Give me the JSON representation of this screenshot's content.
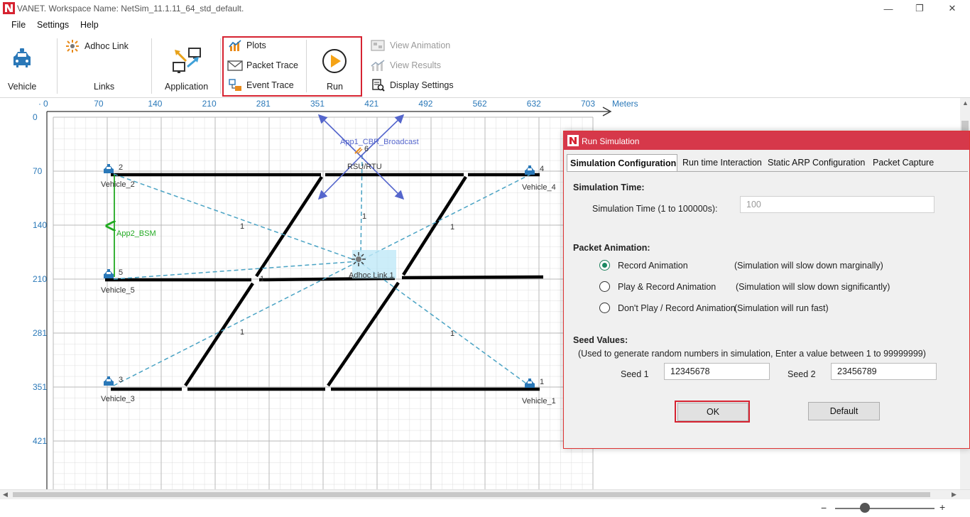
{
  "window": {
    "title": "VANET. Workspace Name: NetSim_11.1.11_64_std_default.",
    "minimize": "—",
    "restore": "❐",
    "close": "✕"
  },
  "menu": [
    "File",
    "Settings",
    "Help"
  ],
  "ribbon": {
    "vehicle": "Vehicle",
    "adhoc_link": "Adhoc Link",
    "links": "Links",
    "application": "Application",
    "plots": "Plots",
    "packet_trace": "Packet Trace",
    "event_trace": "Event Trace",
    "run": "Run",
    "view_animation": "View Animation",
    "view_results": "View Results",
    "display_settings": "Display Settings"
  },
  "grid": {
    "x_ticks": [
      "0",
      "70",
      "140",
      "210",
      "281",
      "351",
      "421",
      "492",
      "562",
      "632",
      "703"
    ],
    "y_ticks": [
      "0",
      "70",
      "140",
      "210",
      "281",
      "351",
      "421"
    ],
    "unit": "Meters",
    "origin_dot": "·"
  },
  "network": {
    "rsu_id": "6",
    "rsu_label": "RSU/RTU",
    "app1": "App1_CBR_Broadcast",
    "app2": "App2_BSM",
    "adhoc_link": "Adhoc Link 1",
    "vehicles": [
      {
        "id": "2",
        "label": "Vehicle_2"
      },
      {
        "id": "4",
        "label": "Vehicle_4"
      },
      {
        "id": "5",
        "label": "Vehicle_5"
      },
      {
        "id": "3",
        "label": "Vehicle_3"
      },
      {
        "id": "1",
        "label": "Vehicle_1"
      }
    ],
    "link_weight": "1"
  },
  "dialog": {
    "title": "Run Simulation",
    "tabs": [
      "Simulation Configuration",
      "Run time Interaction",
      "Static ARP Configuration",
      "Packet Capture"
    ],
    "sim_time_heading": "Simulation Time:",
    "sim_time_label": "Simulation Time (1 to 100000s):",
    "sim_time_value": "100",
    "packet_anim_heading": "Packet Animation:",
    "anim_options": [
      {
        "label": "Record Animation",
        "note": "(Simulation will slow down marginally)",
        "checked": true
      },
      {
        "label": "Play & Record Animation",
        "note": "(Simulation will slow down significantly)",
        "checked": false
      },
      {
        "label": "Don't Play / Record Animation",
        "note": "(Simulation will run fast)",
        "checked": false
      }
    ],
    "seed_heading": "Seed Values:",
    "seed_note": "(Used to generate random numbers in simulation, Enter a value between 1 to 99999999)",
    "seed1_label": "Seed 1",
    "seed1_value": "12345678",
    "seed2_label": "Seed 2",
    "seed2_value": "23456789",
    "ok": "OK",
    "default": "Default"
  },
  "status": {
    "zoom_minus": "−",
    "zoom_plus": "+"
  },
  "colors": {
    "accent_red": "#d62331",
    "dialog_title": "#d6384a",
    "axis_blue": "#2a78b8",
    "link_dash": "#4aa3c4",
    "app_arrow": "#5566cc",
    "bsm_green": "#22aa22"
  }
}
